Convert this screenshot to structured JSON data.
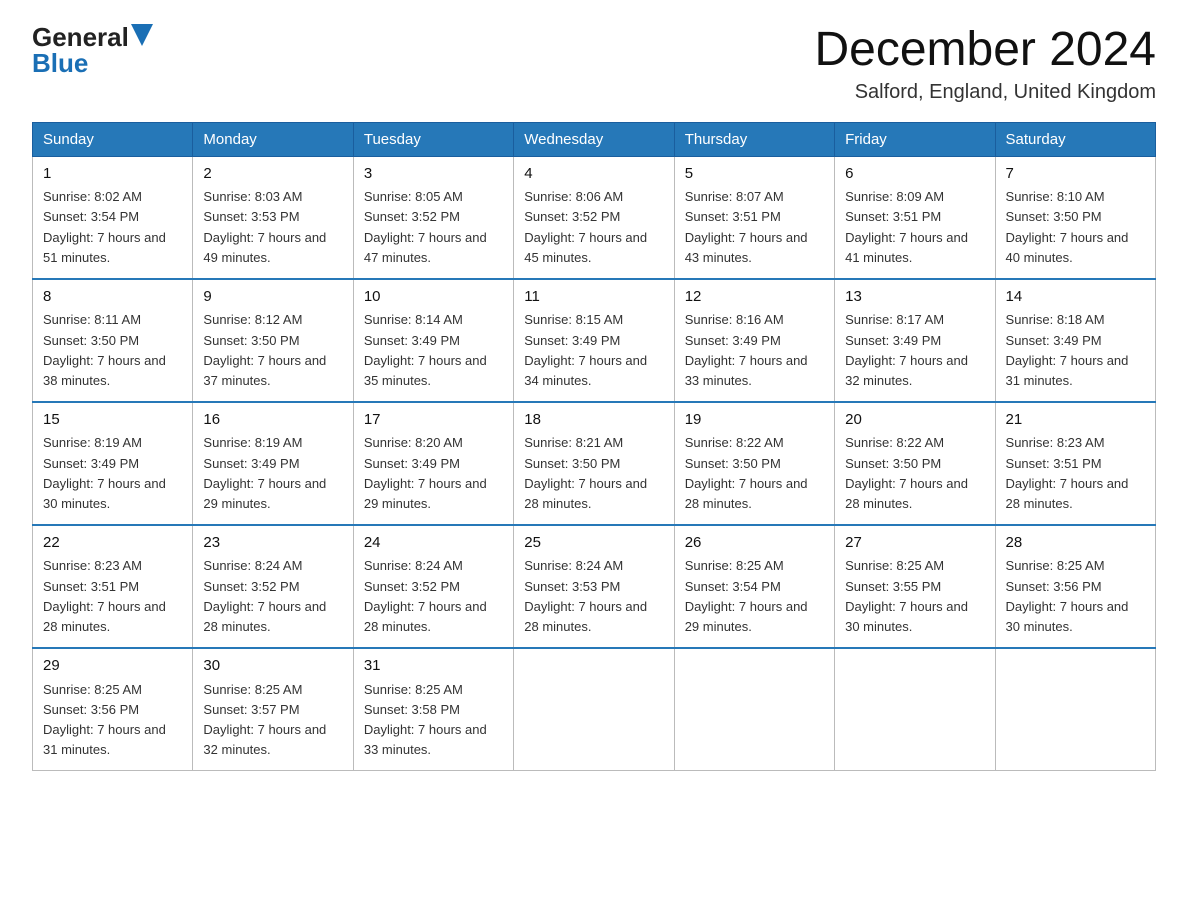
{
  "logo": {
    "general": "General",
    "blue": "Blue"
  },
  "title": "December 2024",
  "location": "Salford, England, United Kingdom",
  "days_of_week": [
    "Sunday",
    "Monday",
    "Tuesday",
    "Wednesday",
    "Thursday",
    "Friday",
    "Saturday"
  ],
  "weeks": [
    [
      {
        "day": "1",
        "sunrise": "Sunrise: 8:02 AM",
        "sunset": "Sunset: 3:54 PM",
        "daylight": "Daylight: 7 hours and 51 minutes."
      },
      {
        "day": "2",
        "sunrise": "Sunrise: 8:03 AM",
        "sunset": "Sunset: 3:53 PM",
        "daylight": "Daylight: 7 hours and 49 minutes."
      },
      {
        "day": "3",
        "sunrise": "Sunrise: 8:05 AM",
        "sunset": "Sunset: 3:52 PM",
        "daylight": "Daylight: 7 hours and 47 minutes."
      },
      {
        "day": "4",
        "sunrise": "Sunrise: 8:06 AM",
        "sunset": "Sunset: 3:52 PM",
        "daylight": "Daylight: 7 hours and 45 minutes."
      },
      {
        "day": "5",
        "sunrise": "Sunrise: 8:07 AM",
        "sunset": "Sunset: 3:51 PM",
        "daylight": "Daylight: 7 hours and 43 minutes."
      },
      {
        "day": "6",
        "sunrise": "Sunrise: 8:09 AM",
        "sunset": "Sunset: 3:51 PM",
        "daylight": "Daylight: 7 hours and 41 minutes."
      },
      {
        "day": "7",
        "sunrise": "Sunrise: 8:10 AM",
        "sunset": "Sunset: 3:50 PM",
        "daylight": "Daylight: 7 hours and 40 minutes."
      }
    ],
    [
      {
        "day": "8",
        "sunrise": "Sunrise: 8:11 AM",
        "sunset": "Sunset: 3:50 PM",
        "daylight": "Daylight: 7 hours and 38 minutes."
      },
      {
        "day": "9",
        "sunrise": "Sunrise: 8:12 AM",
        "sunset": "Sunset: 3:50 PM",
        "daylight": "Daylight: 7 hours and 37 minutes."
      },
      {
        "day": "10",
        "sunrise": "Sunrise: 8:14 AM",
        "sunset": "Sunset: 3:49 PM",
        "daylight": "Daylight: 7 hours and 35 minutes."
      },
      {
        "day": "11",
        "sunrise": "Sunrise: 8:15 AM",
        "sunset": "Sunset: 3:49 PM",
        "daylight": "Daylight: 7 hours and 34 minutes."
      },
      {
        "day": "12",
        "sunrise": "Sunrise: 8:16 AM",
        "sunset": "Sunset: 3:49 PM",
        "daylight": "Daylight: 7 hours and 33 minutes."
      },
      {
        "day": "13",
        "sunrise": "Sunrise: 8:17 AM",
        "sunset": "Sunset: 3:49 PM",
        "daylight": "Daylight: 7 hours and 32 minutes."
      },
      {
        "day": "14",
        "sunrise": "Sunrise: 8:18 AM",
        "sunset": "Sunset: 3:49 PM",
        "daylight": "Daylight: 7 hours and 31 minutes."
      }
    ],
    [
      {
        "day": "15",
        "sunrise": "Sunrise: 8:19 AM",
        "sunset": "Sunset: 3:49 PM",
        "daylight": "Daylight: 7 hours and 30 minutes."
      },
      {
        "day": "16",
        "sunrise": "Sunrise: 8:19 AM",
        "sunset": "Sunset: 3:49 PM",
        "daylight": "Daylight: 7 hours and 29 minutes."
      },
      {
        "day": "17",
        "sunrise": "Sunrise: 8:20 AM",
        "sunset": "Sunset: 3:49 PM",
        "daylight": "Daylight: 7 hours and 29 minutes."
      },
      {
        "day": "18",
        "sunrise": "Sunrise: 8:21 AM",
        "sunset": "Sunset: 3:50 PM",
        "daylight": "Daylight: 7 hours and 28 minutes."
      },
      {
        "day": "19",
        "sunrise": "Sunrise: 8:22 AM",
        "sunset": "Sunset: 3:50 PM",
        "daylight": "Daylight: 7 hours and 28 minutes."
      },
      {
        "day": "20",
        "sunrise": "Sunrise: 8:22 AM",
        "sunset": "Sunset: 3:50 PM",
        "daylight": "Daylight: 7 hours and 28 minutes."
      },
      {
        "day": "21",
        "sunrise": "Sunrise: 8:23 AM",
        "sunset": "Sunset: 3:51 PM",
        "daylight": "Daylight: 7 hours and 28 minutes."
      }
    ],
    [
      {
        "day": "22",
        "sunrise": "Sunrise: 8:23 AM",
        "sunset": "Sunset: 3:51 PM",
        "daylight": "Daylight: 7 hours and 28 minutes."
      },
      {
        "day": "23",
        "sunrise": "Sunrise: 8:24 AM",
        "sunset": "Sunset: 3:52 PM",
        "daylight": "Daylight: 7 hours and 28 minutes."
      },
      {
        "day": "24",
        "sunrise": "Sunrise: 8:24 AM",
        "sunset": "Sunset: 3:52 PM",
        "daylight": "Daylight: 7 hours and 28 minutes."
      },
      {
        "day": "25",
        "sunrise": "Sunrise: 8:24 AM",
        "sunset": "Sunset: 3:53 PM",
        "daylight": "Daylight: 7 hours and 28 minutes."
      },
      {
        "day": "26",
        "sunrise": "Sunrise: 8:25 AM",
        "sunset": "Sunset: 3:54 PM",
        "daylight": "Daylight: 7 hours and 29 minutes."
      },
      {
        "day": "27",
        "sunrise": "Sunrise: 8:25 AM",
        "sunset": "Sunset: 3:55 PM",
        "daylight": "Daylight: 7 hours and 30 minutes."
      },
      {
        "day": "28",
        "sunrise": "Sunrise: 8:25 AM",
        "sunset": "Sunset: 3:56 PM",
        "daylight": "Daylight: 7 hours and 30 minutes."
      }
    ],
    [
      {
        "day": "29",
        "sunrise": "Sunrise: 8:25 AM",
        "sunset": "Sunset: 3:56 PM",
        "daylight": "Daylight: 7 hours and 31 minutes."
      },
      {
        "day": "30",
        "sunrise": "Sunrise: 8:25 AM",
        "sunset": "Sunset: 3:57 PM",
        "daylight": "Daylight: 7 hours and 32 minutes."
      },
      {
        "day": "31",
        "sunrise": "Sunrise: 8:25 AM",
        "sunset": "Sunset: 3:58 PM",
        "daylight": "Daylight: 7 hours and 33 minutes."
      },
      null,
      null,
      null,
      null
    ]
  ]
}
